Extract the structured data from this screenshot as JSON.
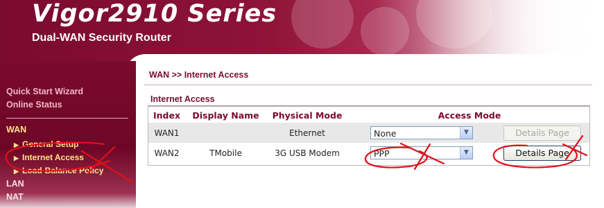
{
  "header": {
    "product_title": "Vigor2910 Series",
    "product_subtitle": "Dual-WAN Security Router"
  },
  "sidebar": {
    "quick_start": "Quick Start Wizard",
    "online_status": "Online Status",
    "wan": "WAN",
    "wan_items": [
      "General Setup",
      "Internet Access",
      "Load-Balance Policy"
    ],
    "lan": "LAN",
    "nat": "NAT"
  },
  "main": {
    "breadcrumb": "WAN >> Internet Access",
    "section_title": "Internet Access",
    "table": {
      "headers": [
        "Index",
        "Display Name",
        "Physical Mode",
        "Access Mode"
      ],
      "rows": [
        {
          "index": "WAN1",
          "display_name": "",
          "physical_mode": "Ethernet",
          "access_mode": "None",
          "details": "Details Page"
        },
        {
          "index": "WAN2",
          "display_name": "TMobile",
          "physical_mode": "3G USB Modem",
          "access_mode": "PPP",
          "details": "Details Page"
        }
      ]
    }
  },
  "colors": {
    "brand": "#7a0a2e",
    "annotation": "#e0101a"
  }
}
